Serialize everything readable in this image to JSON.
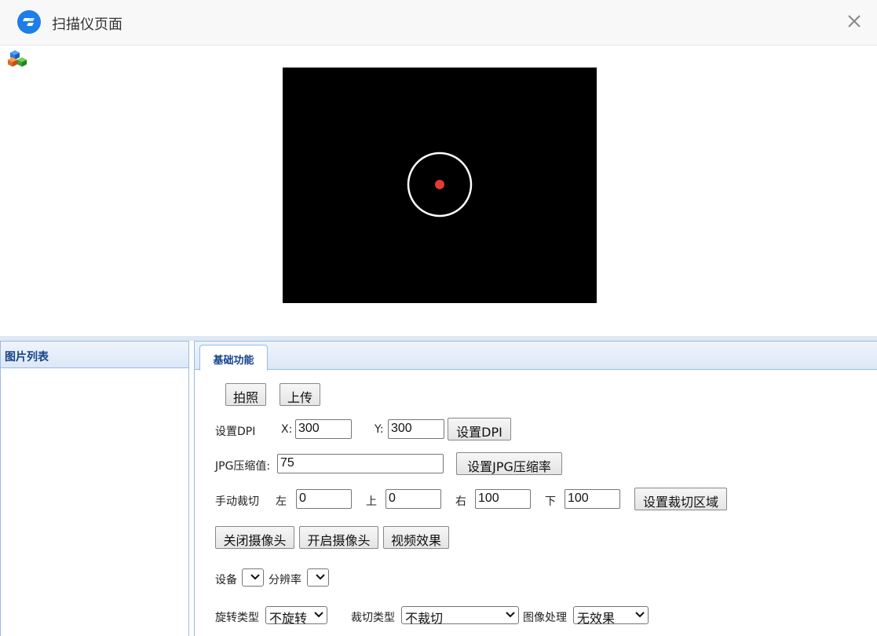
{
  "window": {
    "title": "扫描仪页面",
    "close_glyph": "×"
  },
  "left_panel": {
    "title": "图片列表"
  },
  "tabs": [
    {
      "label": "基础功能",
      "active": true
    }
  ],
  "controls": {
    "capture_button": "拍照",
    "upload_button": "上传",
    "dpi": {
      "label": "设置DPI",
      "x_label": "X:",
      "x_value": "300",
      "y_label": "Y:",
      "y_value": "300",
      "button": "设置DPI"
    },
    "jpg": {
      "label": "JPG压缩值:",
      "value": "75",
      "button": "设置JPG压缩率"
    },
    "crop": {
      "label": "手动裁切",
      "left_label": "左",
      "left_value": "0",
      "top_label": "上",
      "top_value": "0",
      "right_label": "右",
      "right_value": "100",
      "bottom_label": "下",
      "bottom_value": "100",
      "button": "设置裁切区域"
    },
    "camera": {
      "close_button": "关闭摄像头",
      "open_button": "开启摄像头",
      "effect_button": "视频效果"
    },
    "device": {
      "label": "设备",
      "value": "",
      "resolution_label": "分辨率",
      "resolution_value": ""
    },
    "processing": {
      "rotate_label": "旋转类型",
      "rotate_value": "不旋转",
      "crop_type_label": "裁切类型",
      "crop_type_value": "不裁切",
      "image_proc_label": "图像处理",
      "image_proc_value": "无效果"
    }
  },
  "colors": {
    "brand": "#1e7ee8",
    "panel_border": "#99bbe8",
    "panel_header_text": "#15428b",
    "focus_dot": "#e53935"
  }
}
